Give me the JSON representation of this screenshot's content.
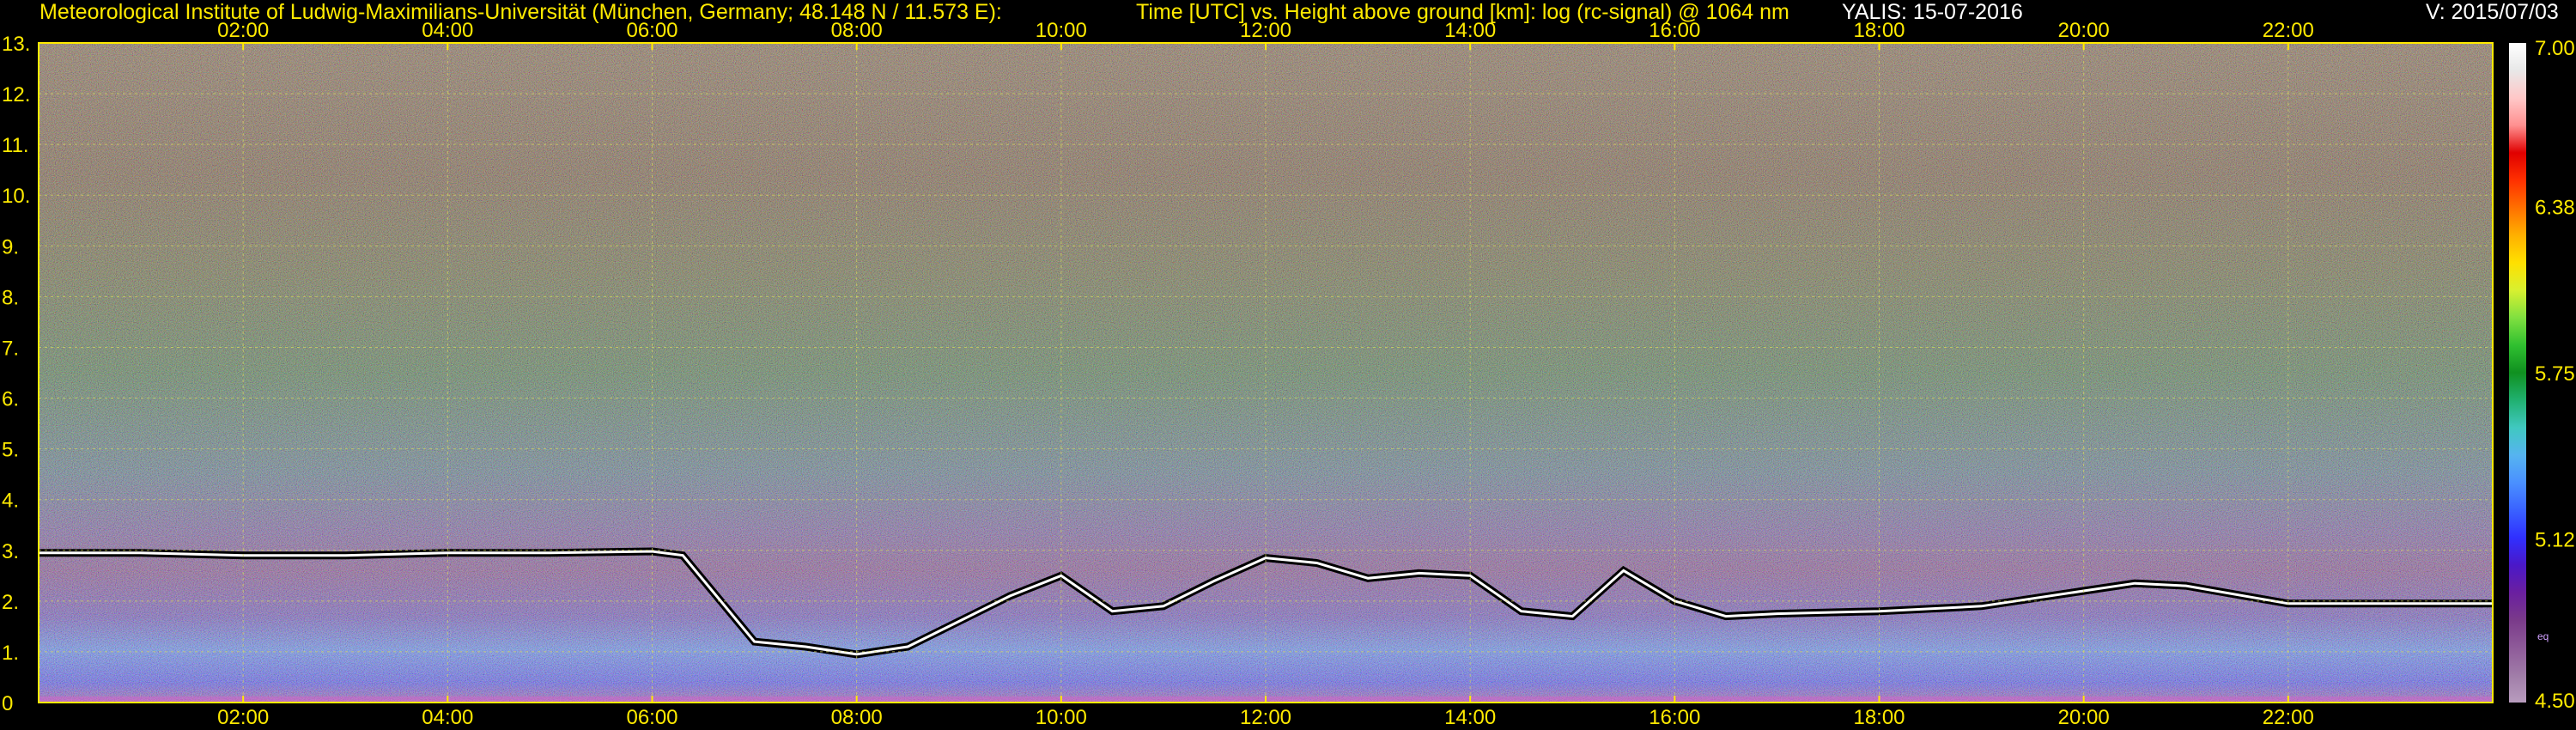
{
  "header": {
    "institute": "Meteorological Institute of Ludwig-Maximilians-Universität (München, Germany; 48.148 N / 11.573 E):",
    "title": "Time [UTC] vs. Height above ground [km]: log (rc-signal) @ 1064 nm",
    "instrument": "YALIS: 15-07-2016",
    "version": "V: 2015/07/03"
  },
  "colorbar": {
    "ticks": [
      "7.00",
      "6.38",
      "5.75",
      "5.12",
      "4.50"
    ],
    "tick_values": [
      7.0,
      6.38,
      5.75,
      5.12,
      4.5
    ],
    "unit_label": "eq",
    "colors": [
      "#b89cbe",
      "#a07ca8",
      "#8e5a99",
      "#7a3a8a",
      "#6a1fa0",
      "#4a18c8",
      "#3030ff",
      "#3a62ff",
      "#4a90ff",
      "#56b4f0",
      "#40c8c0",
      "#20b070",
      "#109020",
      "#30c030",
      "#80e040",
      "#d8f030",
      "#ffe000",
      "#ffb000",
      "#ff7000",
      "#ff3000",
      "#e00000",
      "#ff9090",
      "#ffc8c8",
      "#e8e8e8",
      "#ffffff"
    ]
  },
  "chart_data": {
    "type": "heatmap",
    "title": "Time [UTC] vs. Height above ground [km]: log (rc-signal) @ 1064 nm",
    "xlabel": "Time [UTC]",
    "ylabel": "Height above ground [km]",
    "xlim": [
      0,
      24
    ],
    "ylim": [
      0,
      13
    ],
    "x_tick_labels": [
      "02:00",
      "04:00",
      "06:00",
      "08:00",
      "10:00",
      "12:00",
      "14:00",
      "16:00",
      "18:00",
      "20:00",
      "22:00"
    ],
    "x_ticks": [
      2,
      4,
      6,
      8,
      10,
      12,
      14,
      16,
      18,
      20,
      22
    ],
    "y_tick_labels": [
      "0",
      "1.",
      "2.",
      "3.",
      "4.",
      "5.",
      "6.",
      "7.",
      "8.",
      "9.",
      "10.",
      "11.",
      "12.",
      "13."
    ],
    "y_ticks": [
      0,
      1,
      2,
      3,
      4,
      5,
      6,
      7,
      8,
      9,
      10,
      11,
      12,
      13
    ],
    "grid": true,
    "colorbar_range": [
      4.5,
      7.0
    ],
    "boundary_layer_top_km": [
      [
        0.0,
        2.95
      ],
      [
        1.0,
        2.95
      ],
      [
        2.0,
        2.9
      ],
      [
        3.0,
        2.9
      ],
      [
        4.0,
        2.95
      ],
      [
        5.0,
        2.95
      ],
      [
        6.0,
        2.98
      ],
      [
        6.3,
        2.9
      ],
      [
        7.0,
        1.2
      ],
      [
        7.5,
        1.1
      ],
      [
        8.0,
        0.95
      ],
      [
        8.5,
        1.1
      ],
      [
        9.0,
        1.6
      ],
      [
        9.5,
        2.1
      ],
      [
        10.0,
        2.5
      ],
      [
        10.5,
        1.8
      ],
      [
        11.0,
        1.9
      ],
      [
        11.5,
        2.4
      ],
      [
        12.0,
        2.85
      ],
      [
        12.5,
        2.75
      ],
      [
        13.0,
        2.45
      ],
      [
        13.5,
        2.55
      ],
      [
        14.0,
        2.5
      ],
      [
        14.5,
        1.8
      ],
      [
        15.0,
        1.7
      ],
      [
        15.5,
        2.6
      ],
      [
        16.0,
        2.0
      ],
      [
        16.5,
        1.7
      ],
      [
        17.0,
        1.75
      ],
      [
        18.0,
        1.8
      ],
      [
        19.0,
        1.9
      ],
      [
        20.0,
        2.2
      ],
      [
        20.5,
        2.35
      ],
      [
        21.0,
        2.3
      ],
      [
        22.0,
        1.95
      ],
      [
        23.0,
        1.95
      ],
      [
        24.0,
        1.95
      ]
    ]
  }
}
